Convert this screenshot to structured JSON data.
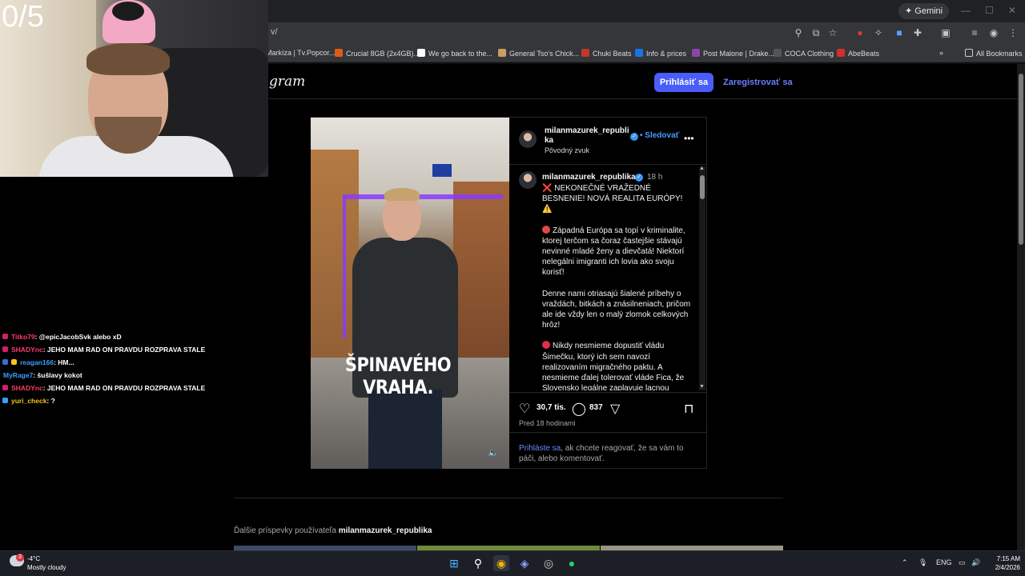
{
  "browser": {
    "gemini_label": "Gemini",
    "url": "v/",
    "bookmarks": [
      {
        "label": "Markíza | Tv.Popcor...",
        "color": "#6b6b6b"
      },
      {
        "label": "Crucial 8GB (2x4GB)...",
        "color": "#e05a1a"
      },
      {
        "label": "We go back to the...",
        "color": "#4285f4"
      },
      {
        "label": "General Tso's Chick...",
        "color": "#c8a060"
      },
      {
        "label": "Chuki Beats",
        "color": "#c0392b"
      },
      {
        "label": "Info & prices",
        "color": "#1a73e8"
      },
      {
        "label": "Post Malone | Drake...",
        "color": "#8e44ad"
      },
      {
        "label": "COCA Clothing",
        "color": "#333333"
      },
      {
        "label": "AbeBeats",
        "color": "#d32f2f"
      }
    ],
    "all_bookmarks": "All Bookmarks"
  },
  "instagram": {
    "logo": "gram",
    "login_button": "Prihlásiť sa",
    "register_button": "Zaregistrovať sa",
    "post": {
      "video_caption": "ŠPINAVÉHO VRAHA.",
      "username_top": "milanmazurek_republi ka",
      "follow": "• Sledovať",
      "audio": "Pôvodný zvuk",
      "username": "milanmazurek_republika",
      "time": "18 h",
      "caption": [
        "❌ NEKONEČNÉ VRAŽEDNÉ BESNENIE! NOVÁ REALITA EURÓPY! ⚠️",
        "Západná Európa sa topí v kriminalite, ktorej terčom sa čoraz častejšie stávajú nevinné mladé ženy a dievčatá! Niektorí nelegálni imigranti ich lovia ako svoju korisť!",
        "Denne nami otriasajú šialené príbehy o vraždách, bitkách a znásilneniach, pričom ale ide vždy len o malý zlomok celkových hrôz!",
        "Nikdy nesmieme dopustiť vládu Šimečku, ktorý ich sem navozí realizovaním migračného paktu. A nesmieme ďalej tolerovať vláde Fica, že Slovensko legálne zaplavuje lacnou pracovnou silou z Indie a Uzbekistanu!"
      ],
      "likes": "30,7 tis.",
      "comments": "837",
      "posted_ago": "Pred 18 hodinami",
      "login_prompt_link": "Prihláste sa",
      "login_prompt_rest": ", ak chcete reagovať, že sa vám to páči, alebo komentovať."
    },
    "more_posts_prefix": "Ďalšie príspevky používateľa",
    "more_posts_user": "milanmazurek_republika"
  },
  "stream": {
    "counter": "0/5",
    "chat": [
      {
        "user": "Titko79",
        "text": ": @epicJacobSvk alebo xD",
        "color": "#ff3b6b",
        "badge": "#d0206a"
      },
      {
        "user": "SHADYnc",
        "text": ": JEHO MAM RAD ON PRAVDU ROZPRAVA STALE",
        "color": "#ff3b6b",
        "badge": "#d0206a"
      },
      {
        "user": "reagan166",
        "text": ": HM...",
        "color": "#3aa0ff",
        "badge": "#3a6bd8"
      },
      {
        "user": "MyRage7",
        "text": ": šušlavy kokot",
        "color": "#3aa0ff",
        "badge": ""
      },
      {
        "user": "SHADYnc",
        "text": ": JEHO MAM RAD ON PRAVDU ROZPRAVA STALE",
        "color": "#ff3b6b",
        "badge": "#d0206a"
      },
      {
        "user": "yuri_check",
        "text": ": ?",
        "color": "#f7c21e",
        "badge": "#3aa0ff"
      }
    ]
  },
  "taskbar": {
    "weather_badge": "3",
    "temperature": "-4°C",
    "condition": "Mostly cloudy",
    "lang": "ENG",
    "time": "7:15 AM",
    "date": "2/4/2026"
  }
}
